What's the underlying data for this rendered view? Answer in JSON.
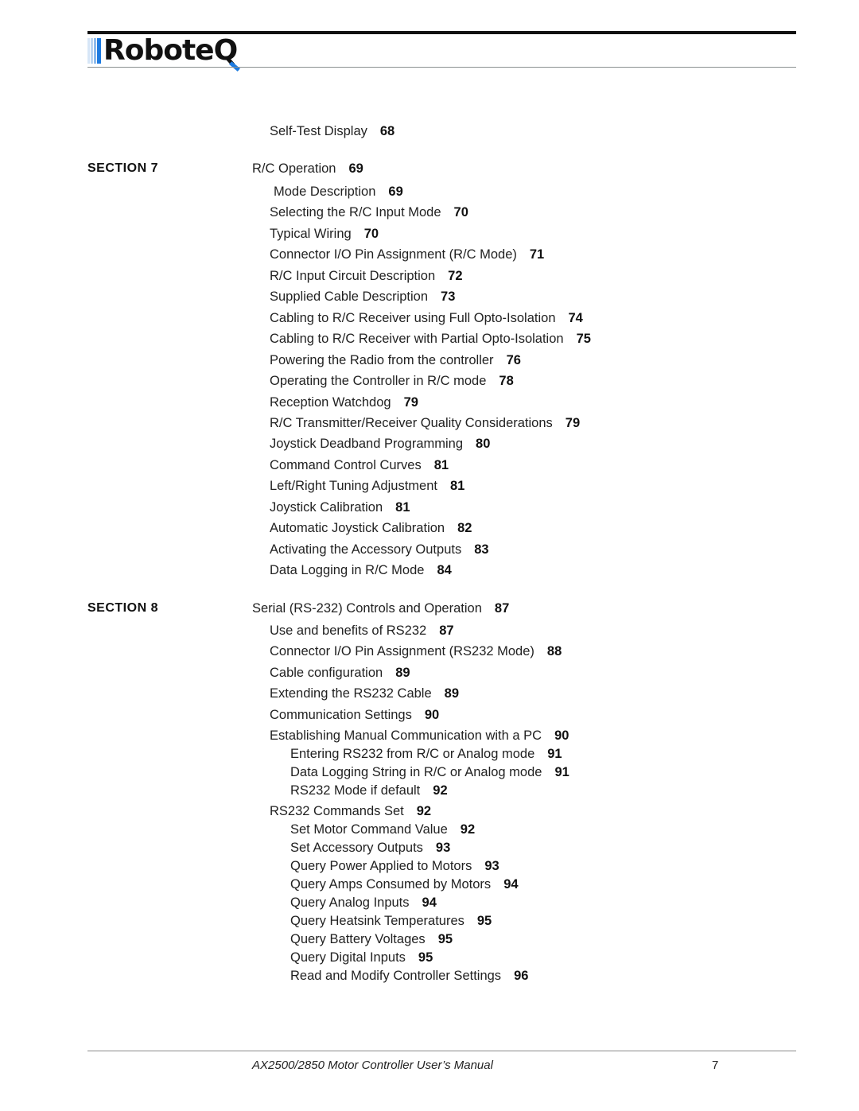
{
  "header": {
    "logo_text": "RoboteQ",
    "logo_colors": {
      "dark": "#111111",
      "accent": "#1e7be0",
      "light": "#bcd6f2"
    }
  },
  "toc": {
    "sections": [
      {
        "label": "SECTION 7"
      },
      {
        "label": "SECTION 8"
      }
    ],
    "entries": [
      {
        "title": "Self-Test Display",
        "page": "68",
        "level": 1
      },
      {
        "title": "R/C Operation",
        "page": "69",
        "level": 0
      },
      {
        "title": "Mode Description",
        "page": "69",
        "level": 1
      },
      {
        "title": "Selecting the R/C Input Mode",
        "page": "70",
        "level": 1
      },
      {
        "title": "Typical Wiring",
        "page": "70",
        "level": 1
      },
      {
        "title": "Connector I/O Pin Assignment (R/C Mode)",
        "page": "71",
        "level": 1
      },
      {
        "title": "R/C Input Circuit Description",
        "page": "72",
        "level": 1
      },
      {
        "title": "Supplied Cable Description",
        "page": "73",
        "level": 1
      },
      {
        "title": "Cabling to R/C Receiver using Full Opto-Isolation",
        "page": "74",
        "level": 1
      },
      {
        "title": "Cabling to R/C Receiver with Partial Opto-Isolation",
        "page": "75",
        "level": 1
      },
      {
        "title": "Powering the Radio from the controller",
        "page": "76",
        "level": 1
      },
      {
        "title": "Operating the Controller in R/C mode",
        "page": "78",
        "level": 1
      },
      {
        "title": "Reception Watchdog",
        "page": "79",
        "level": 1
      },
      {
        "title": "R/C Transmitter/Receiver Quality Considerations",
        "page": "79",
        "level": 1
      },
      {
        "title": "Joystick Deadband Programming",
        "page": "80",
        "level": 1
      },
      {
        "title": "Command Control Curves",
        "page": "81",
        "level": 1
      },
      {
        "title": "Left/Right Tuning Adjustment",
        "page": "81",
        "level": 1
      },
      {
        "title": "Joystick Calibration",
        "page": "81",
        "level": 1
      },
      {
        "title": "Automatic Joystick Calibration",
        "page": "82",
        "level": 1
      },
      {
        "title": "Activating the Accessory Outputs",
        "page": "83",
        "level": 1
      },
      {
        "title": "Data Logging in R/C Mode",
        "page": "84",
        "level": 1
      },
      {
        "title": "Serial (RS-232) Controls and Operation",
        "page": "87",
        "level": 0
      },
      {
        "title": "Use and benefits of RS232",
        "page": "87",
        "level": 1
      },
      {
        "title": "Connector I/O Pin Assignment (RS232 Mode)",
        "page": "88",
        "level": 1
      },
      {
        "title": "Cable configuration",
        "page": "89",
        "level": 1
      },
      {
        "title": "Extending the RS232 Cable",
        "page": "89",
        "level": 1
      },
      {
        "title": "Communication Settings",
        "page": "90",
        "level": 1
      },
      {
        "title": "Establishing Manual Communication with a PC",
        "page": "90",
        "level": 1
      },
      {
        "title": "Entering RS232 from R/C or Analog mode",
        "page": "91",
        "level": 2
      },
      {
        "title": "Data Logging String in R/C or Analog mode",
        "page": "91",
        "level": 2
      },
      {
        "title": "RS232 Mode if default",
        "page": "92",
        "level": 2
      },
      {
        "title": "RS232 Commands Set",
        "page": "92",
        "level": 1
      },
      {
        "title": "Set Motor Command Value",
        "page": "92",
        "level": 2
      },
      {
        "title": "Set Accessory Outputs",
        "page": "93",
        "level": 2
      },
      {
        "title": "Query Power Applied to Motors",
        "page": "93",
        "level": 2
      },
      {
        "title": "Query Amps Consumed by Motors",
        "page": "94",
        "level": 2
      },
      {
        "title": "Query Analog Inputs",
        "page": "94",
        "level": 2
      },
      {
        "title": "Query Heatsink Temperatures",
        "page": "95",
        "level": 2
      },
      {
        "title": "Query Battery Voltages",
        "page": "95",
        "level": 2
      },
      {
        "title": "Query Digital Inputs",
        "page": "95",
        "level": 2
      },
      {
        "title": "Read and Modify Controller Settings",
        "page": "96",
        "level": 2
      }
    ]
  },
  "footer": {
    "title": "AX2500/2850 Motor Controller User’s Manual",
    "page_number": "7"
  }
}
